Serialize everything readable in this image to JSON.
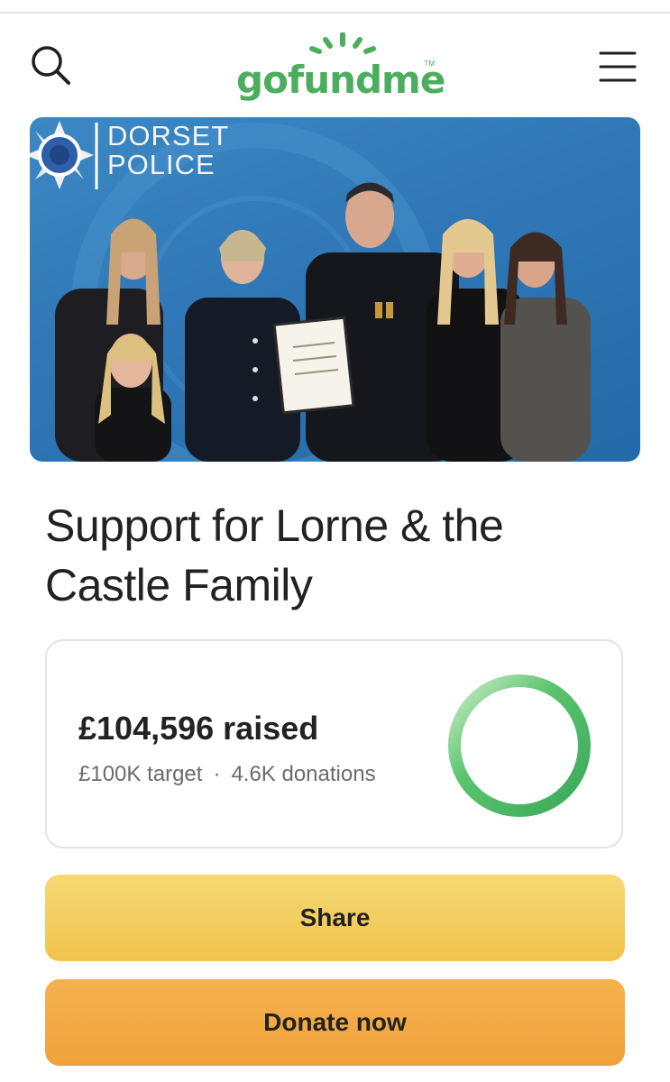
{
  "header": {
    "logo_text": "gofundme",
    "logo_tm": "TM",
    "search_icon": "search-icon",
    "menu_icon": "hamburger-menu-icon"
  },
  "hero": {
    "badge_line1": "DORSET",
    "badge_line2": "POLICE",
    "crest_text": "DORSET POLICE"
  },
  "campaign": {
    "title": "Support for Lorne & the Castle Family",
    "raised_amount": "£104,596",
    "raised_word": "raised",
    "target": "£100K target",
    "separator": "·",
    "donations": "4.6K donations",
    "progress_fraction": 1.0
  },
  "actions": {
    "share_label": "Share",
    "donate_label": "Donate now"
  },
  "colors": {
    "brand_green": "#4aae5c",
    "share_yellow": "#f2c94c",
    "donate_orange": "#f0a23c",
    "hero_blue": "#2f77b6"
  }
}
